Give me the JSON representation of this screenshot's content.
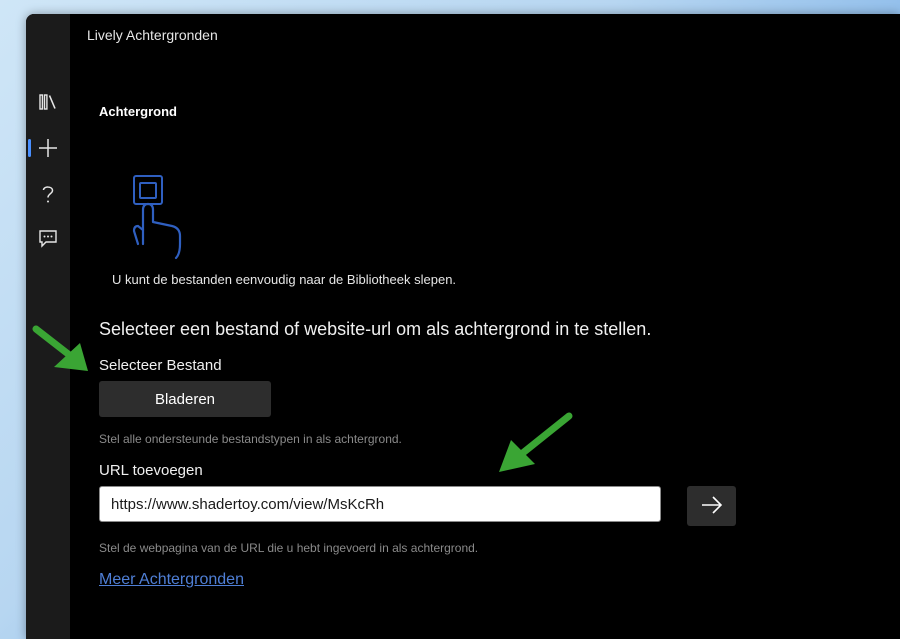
{
  "window": {
    "title": "Lively Achtergronden"
  },
  "nav": {
    "items": [
      "library-icon",
      "add-icon",
      "help-icon",
      "feedback-icon"
    ],
    "active": "add-icon"
  },
  "main": {
    "section_title": "Achtergrond",
    "drag_hint": "U kunt de bestanden eenvoudig naar de Bibliotheek slepen.",
    "instruction": "Selecteer een bestand of website-url om als achtergrond in te stellen.",
    "file": {
      "label": "Selecteer Bestand",
      "button_label": "Bladeren",
      "hint": "Stel alle ondersteunde bestandstypen in als achtergrond."
    },
    "url": {
      "label": "URL toevoegen",
      "value": "https://www.shadertoy.com/view/MsKcRh",
      "hint": "Stel de webpagina van de URL die u hebt ingevoerd in als achtergrond."
    },
    "more_link": "Meer Achtergronden"
  },
  "colors": {
    "accent": "#4a90ff",
    "link": "#4f7fd6",
    "annotation_arrow": "#3aa534"
  }
}
